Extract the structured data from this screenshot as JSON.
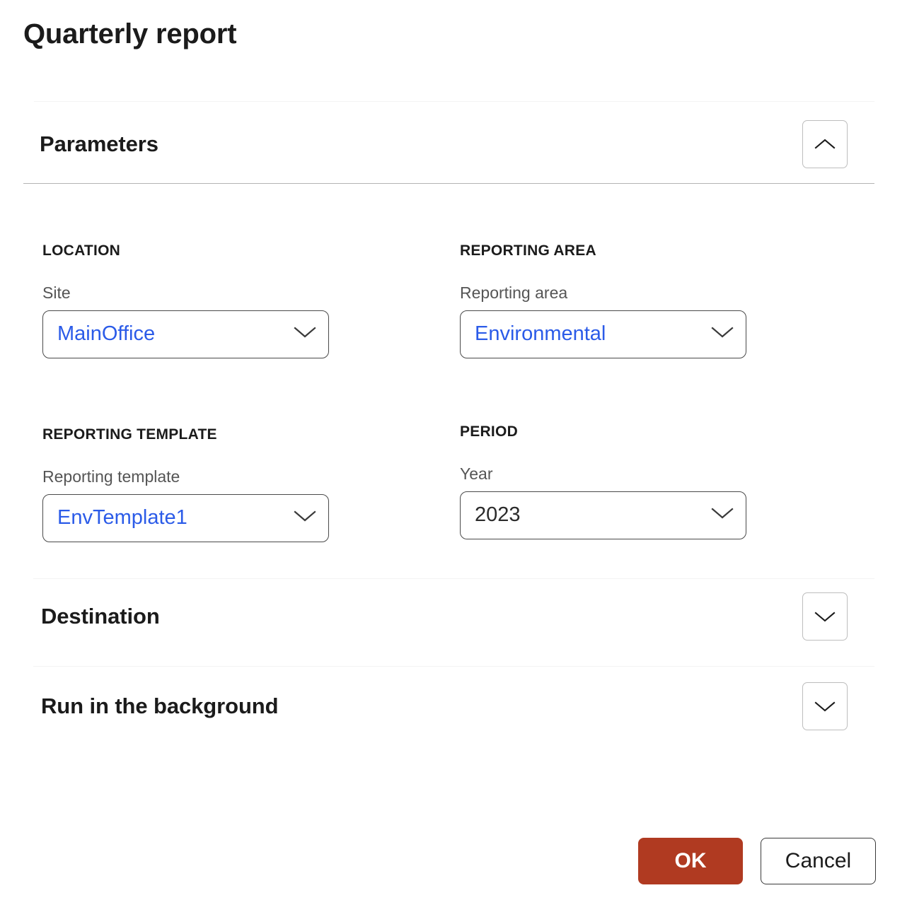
{
  "dialog": {
    "title": "Quarterly report"
  },
  "sections": [
    {
      "id": "parameters",
      "title": "Parameters",
      "toggle_icon": "chevron-up-icon",
      "expanded": true
    },
    {
      "id": "destination",
      "title": "Destination",
      "toggle_icon": "chevron-down-icon",
      "expanded": false
    },
    {
      "id": "run-in-the-background",
      "title": "Run in the background",
      "toggle_icon": "chevron-down-icon",
      "expanded": false
    }
  ],
  "parameters": {
    "groups": [
      {
        "id": "location",
        "caption": "LOCATION",
        "field_label": "Site",
        "value": "MainOffice",
        "value_style": "accent",
        "caret_icon": "chevron-down-icon"
      },
      {
        "id": "reporting-area",
        "caption": "REPORTING AREA",
        "field_label": "Reporting area",
        "value": "Environmental",
        "value_style": "accent",
        "caret_icon": "chevron-down-icon"
      },
      {
        "id": "reporting-template",
        "caption": "REPORTING TEMPLATE",
        "field_label": "Reporting template",
        "value": "EnvTemplate1",
        "value_style": "accent",
        "caret_icon": "chevron-down-icon"
      },
      {
        "id": "period",
        "caption": "PERIOD",
        "field_label": "Year",
        "value": "2023",
        "value_style": "plain",
        "caret_icon": "chevron-down-icon"
      }
    ]
  },
  "footer": {
    "ok_label": "OK",
    "cancel_label": "Cancel"
  },
  "colors": {
    "accent_value": "#2b5be8",
    "primary_button": "#b03a21",
    "primary_button_text": "#ffffff",
    "text": "#1b1b1b",
    "muted_text": "#555555",
    "field_border": "#4a4a4a",
    "toggle_border": "#bdbdbd",
    "rule_light": "#f3f3f3",
    "rule_strong": "#b4b4b4"
  }
}
